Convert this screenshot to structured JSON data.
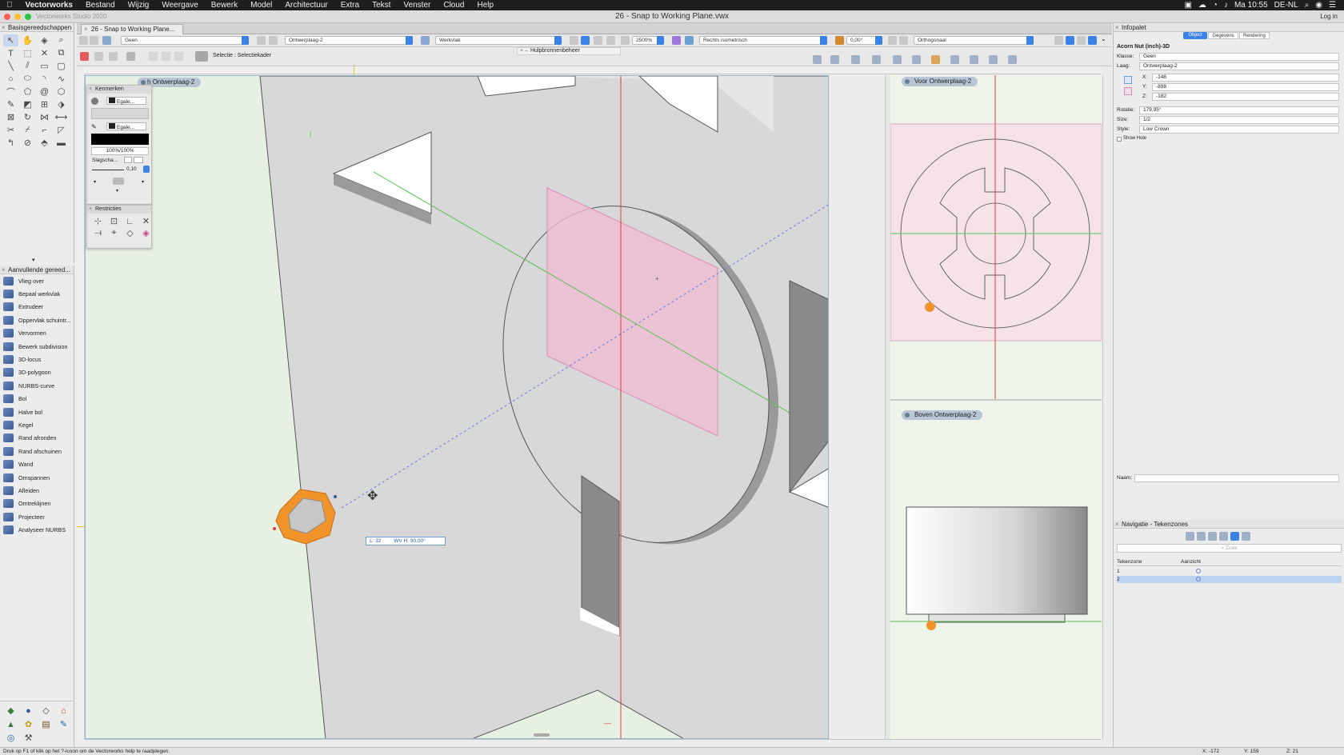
{
  "menubar": {
    "app": "Vectorworks",
    "items": [
      "Bestand",
      "Wijzig",
      "Weergave",
      "Bewerk",
      "Model",
      "Architectuur",
      "Extra",
      "Tekst",
      "Venster",
      "Cloud",
      "Help"
    ],
    "clock": "Ma 10:55",
    "locale": "DE-NL"
  },
  "window": {
    "app_version": "Vectorworks Studio 2020",
    "title": "26 - Snap to Working Plane.vwx",
    "login": "Log in"
  },
  "tools_panel": {
    "title": "Basisgereedschappen"
  },
  "extra_tools": {
    "title": "Aanvullende gereed...",
    "items": [
      "Vlieg over",
      "Bepaal werkvlak",
      "Extrudeer",
      "Oppervlak schuintr...",
      "Vervormen",
      "Bewerk subdivision",
      "3D-locus",
      "3D-polygoon",
      "NURBS-curve",
      "Bol",
      "Halve bol",
      "Kegel",
      "Rand afronden",
      "Rand afschuinen",
      "Wand",
      "Omspannen",
      "Afleiden",
      "Omtreklijnen",
      "Projecteer",
      "Analyseer NURBS"
    ]
  },
  "document": {
    "tab": "26 - Snap to Working Plane..."
  },
  "view_bar": {
    "class": "Geen",
    "layer": "Ontwerplaag-2",
    "plane": "Werkvlak",
    "zoom": "2500%",
    "view": "Rechts isometrisch",
    "angle": "0,00°",
    "render": "Orthogonaal"
  },
  "mode_bar": {
    "mode_label": "Selectie : Selectiekader"
  },
  "resource_tab": "Hulpbronnenbeheer",
  "kenmerken": {
    "title": "Kenmerken",
    "fill": "Egale...",
    "pen": "Egale...",
    "opacity": "100%/100%",
    "shadow": "Slagscha...",
    "lineweight": "0,10"
  },
  "restricties": {
    "title": "Restricties"
  },
  "viewport_labels": {
    "main": "Ontwerplaag-2",
    "main_prefix": "h",
    "front": "Voor  Ontwerplaag-2",
    "top": "Boven  Ontwerplaag-2"
  },
  "data_bar": {
    "l_label": "L:",
    "l_value": "32",
    "wv_label": "WV H:",
    "wv_value": "90,00°"
  },
  "infopalet": {
    "title": "Infopalet",
    "tabs": [
      "Object",
      "Gegevens",
      "Rendering"
    ],
    "object_name": "Acorn Nut (inch)-3D",
    "klasse_label": "Klasse:",
    "klasse": "Geen",
    "laag_label": "Laag:",
    "laag": "Ontwerplaag-2",
    "x_label": "X:",
    "x": "-148",
    "y_label": "Y:",
    "y": "-898",
    "z_label": "Z:",
    "z": "-182",
    "rotatie_label": "Rotatie:",
    "rotatie": "179,95°",
    "size_label": "Size:",
    "size": "1/2",
    "style_label": "Style:",
    "style": "Low Crown",
    "show_hole": "Show Hole",
    "naam_label": "Naam:"
  },
  "nav_panel": {
    "title": "Navigatie - Tekenzones",
    "search_placeholder": "Zoek",
    "col_zone": "Tekenzone",
    "col_view": "Aanzicht",
    "rows": [
      "1",
      "2"
    ]
  },
  "statusbar": {
    "hint": "Druk op F1 of klik op het ?-icoon om de Vectorworks help te raadplegen.",
    "x": "X: -172",
    "y": "Y: 159",
    "z": "Z: 21"
  },
  "colors": {
    "accent": "#3b82e6",
    "selection_orange": "#f0932b",
    "working_plane_pink": "#f3bcd4"
  }
}
